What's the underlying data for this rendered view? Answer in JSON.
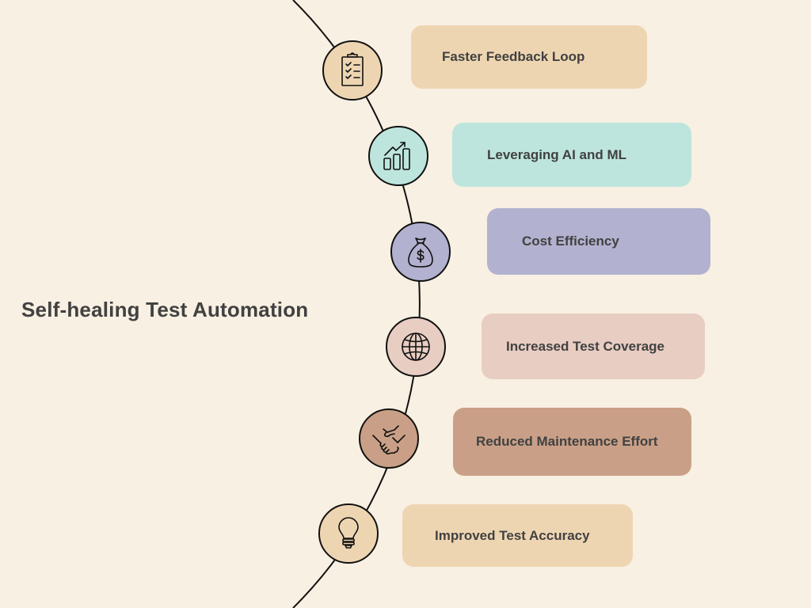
{
  "title": "Self-healing Test Automation",
  "colors": {
    "background": "#f8f0e2",
    "line": "#111111",
    "text": "#414141"
  },
  "items": [
    {
      "label": "Faster Feedback Loop",
      "icon": "clipboard-checklist-icon",
      "color": "#eed5b2"
    },
    {
      "label": "Leveraging AI and ML",
      "icon": "growth-chart-icon",
      "color": "#bde5dd"
    },
    {
      "label": "Cost Efficiency",
      "icon": "money-bag-icon",
      "color": "#b2b1cf"
    },
    {
      "label": "Increased Test Coverage",
      "icon": "globe-icon",
      "color": "#e8cdc2"
    },
    {
      "label": "Reduced Maintenance Effort",
      "icon": "handshake-icon",
      "color": "#c9a087"
    },
    {
      "label": "Improved Test Accuracy",
      "icon": "lightbulb-icon",
      "color": "#eed5b2"
    }
  ]
}
